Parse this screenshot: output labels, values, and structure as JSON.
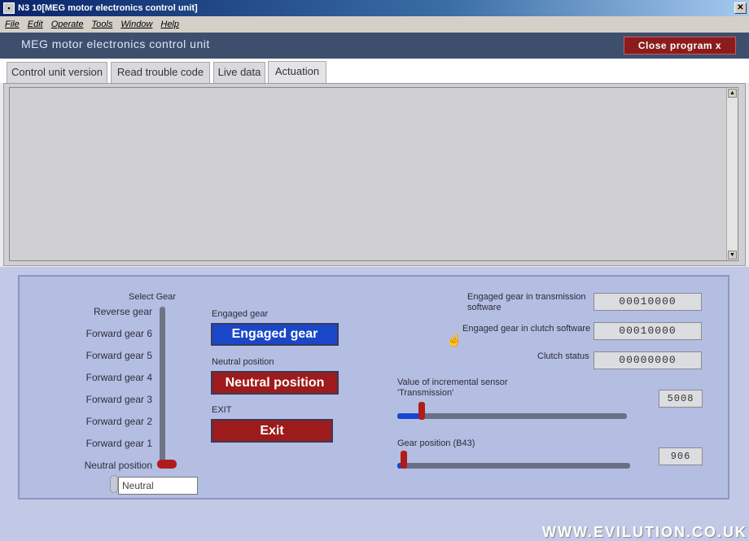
{
  "window": {
    "title": "N3 10[MEG motor electronics control unit]"
  },
  "menu": [
    "File",
    "Edit",
    "Operate",
    "Tools",
    "Window",
    "Help"
  ],
  "header": {
    "title": "MEG   motor electronics control unit",
    "close_label": "Close program x"
  },
  "tabs": [
    "Control unit version",
    "Read trouble code",
    "Live data",
    "Actuation"
  ],
  "active_tab": "Actuation",
  "select_gear": {
    "title": "Select Gear",
    "options": [
      "Reverse gear",
      "Forward gear 6",
      "Forward gear 5",
      "Forward gear 4",
      "Forward gear 3",
      "Forward gear 2",
      "Forward gear 1",
      "Neutral position"
    ],
    "value": "Neutral"
  },
  "engaged": {
    "label": "Engaged gear",
    "button": "Engaged gear"
  },
  "neutral": {
    "label": "Neutral position",
    "button": "Neutral position"
  },
  "exit": {
    "label": "EXIT",
    "button": "Exit"
  },
  "status": {
    "engaged_trans_label": "Engaged gear in transmission software",
    "engaged_trans_value": "00010000",
    "engaged_clutch_label": "Engaged gear in clutch software",
    "engaged_clutch_value": "00010000",
    "clutch_status_label": "Clutch status",
    "clutch_status_value": "00000000"
  },
  "sensors": {
    "incremental_label": "Value of incremental sensor 'Transmission'",
    "incremental_value": "5008",
    "incremental_level": 0.1,
    "gear_position_label": "Gear position (B43)",
    "gear_position_value": "906",
    "gear_position_level": 0.02
  },
  "watermark": "WWW.EVILUTION.CO.UK"
}
